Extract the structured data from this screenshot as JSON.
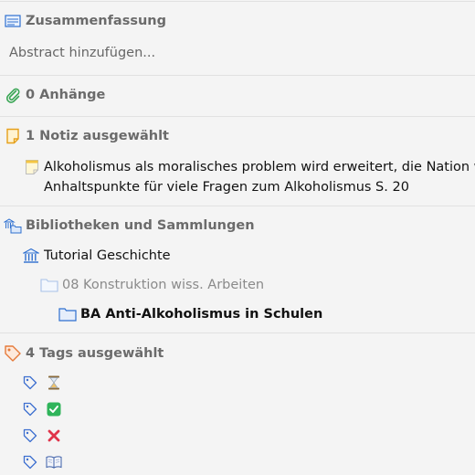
{
  "abstract": {
    "header": "Zusammenfassung",
    "placeholder": "Abstract hinzufügen..."
  },
  "attachments": {
    "header": "0 Anhänge"
  },
  "notes": {
    "header": "1 Notiz ausgewählt",
    "note_line1": "Alkoholismus als moralisches problem wird erweitert, die Nation w",
    "note_line2": "Anhaltspunkte für viele Fragen zum Alkoholismus S. 20"
  },
  "libraries": {
    "header": "Bibliotheken und Sammlungen",
    "library": "Tutorial Geschichte",
    "collection": "08 Konstruktion wiss. Arbeiten",
    "subcollection": "BA Anti-Alkoholismus in Schulen"
  },
  "tags": {
    "header": "4 Tags ausgewählt",
    "items": [
      {
        "emoji": "⏳"
      },
      {
        "emoji": "✅"
      },
      {
        "emoji": "❌"
      },
      {
        "emoji": "📖"
      }
    ]
  },
  "colors": {
    "section_header": "#6b6b6b",
    "folder_blue": "#2e6fcf",
    "attachment_green": "#3aa655",
    "note_yellow": "#e6a01b",
    "tag_orange": "#e57a3a",
    "tag_blue": "#3d6fd0"
  }
}
